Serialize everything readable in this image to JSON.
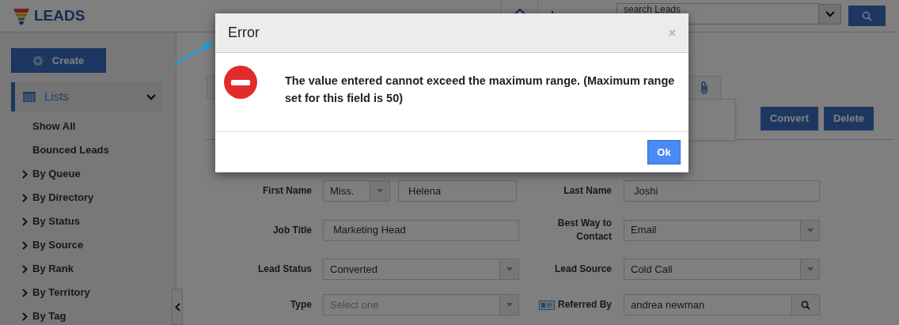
{
  "app": {
    "title": "LEADS"
  },
  "search": {
    "placeholder": "search Leads"
  },
  "sidebar": {
    "create_button": "Create",
    "lists": {
      "label": "Lists",
      "expanded": true
    },
    "items": [
      {
        "label": "Show All",
        "kind": "link"
      },
      {
        "label": "Bounced Leads",
        "kind": "link"
      },
      {
        "label": "By Queue",
        "kind": "group"
      },
      {
        "label": "By Directory",
        "kind": "group"
      },
      {
        "label": "By Status",
        "kind": "group"
      },
      {
        "label": "By Source",
        "kind": "group"
      },
      {
        "label": "By Rank",
        "kind": "group"
      },
      {
        "label": "By Territory",
        "kind": "group"
      },
      {
        "label": "By Tag",
        "kind": "group"
      }
    ]
  },
  "toolbar": {
    "buttons": [
      "Convert",
      "Delete"
    ]
  },
  "form": {
    "rows": [
      {
        "left": {
          "label": "First Name",
          "kind": "name",
          "salutation": "Miss.",
          "value": "Helena"
        },
        "right": {
          "label": "Last Name",
          "kind": "text",
          "value": "Joshi"
        }
      },
      {
        "left": {
          "label": "Job Title",
          "kind": "text",
          "value": "Marketing Head"
        },
        "right": {
          "label": "Best Way to Contact",
          "kind": "select",
          "value": "Email"
        }
      },
      {
        "left": {
          "label": "Lead Status",
          "kind": "select",
          "value": "Converted"
        },
        "right": {
          "label": "Lead Source",
          "kind": "select",
          "value": "Cold Call"
        }
      },
      {
        "left": {
          "label": "Type",
          "kind": "select",
          "placeholder": "Select one"
        },
        "right": {
          "label": "Referred By",
          "kind": "lookup",
          "value": "andrea newman"
        }
      }
    ]
  },
  "dialog": {
    "title": "Error",
    "message": "The value entered cannot exceed the maximum range. (Maximum range set for this field is 50)",
    "buttons": [
      "Ok"
    ]
  }
}
